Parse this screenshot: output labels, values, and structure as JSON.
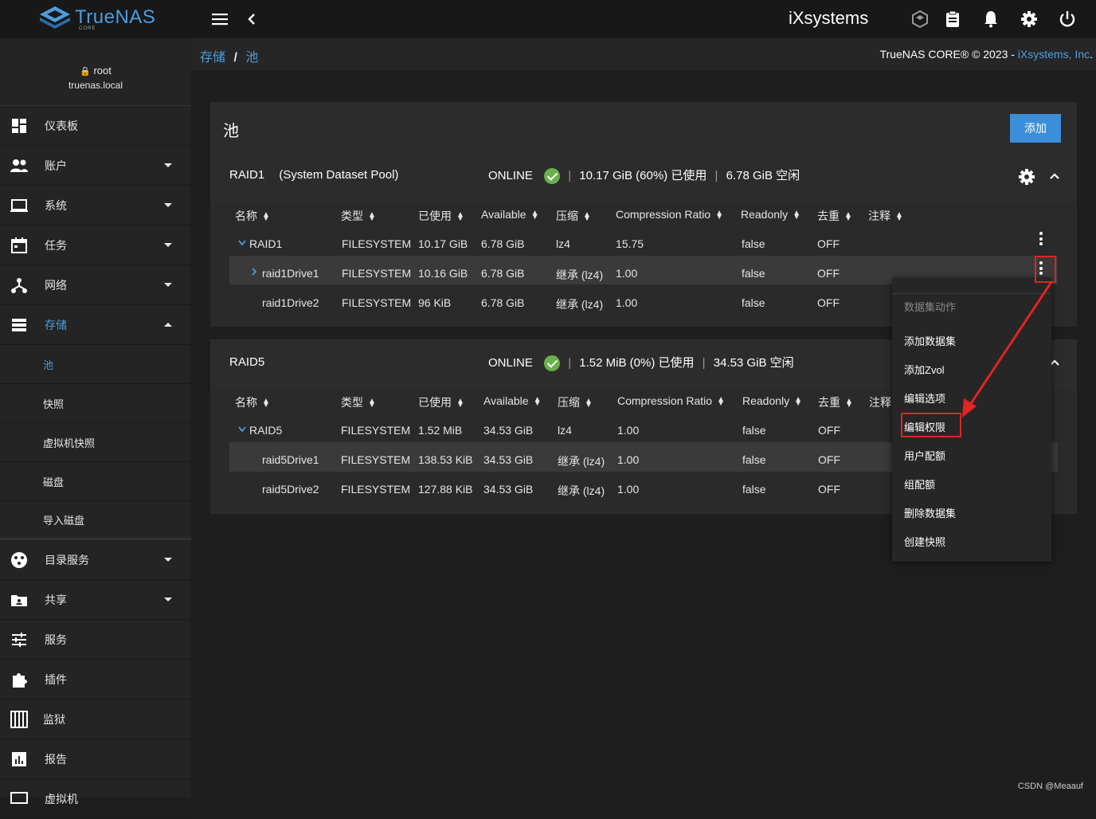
{
  "topbar": {
    "logo_text": "TrueNAS",
    "logo_sub": "CORE",
    "ix_logo": "iXsystems",
    "icons": [
      "menu-icon",
      "back-icon",
      "truecommand-icon",
      "clipboard-icon",
      "bell-icon",
      "gear-icon",
      "power-icon"
    ]
  },
  "user": {
    "name": "root",
    "host": "truenas.local"
  },
  "sidebar": {
    "items": [
      {
        "label": "仪表板",
        "icon": "dashboard-icon"
      },
      {
        "label": "账户",
        "icon": "accounts-icon"
      },
      {
        "label": "系统",
        "icon": "laptop-icon"
      },
      {
        "label": "任务",
        "icon": "calendar-icon"
      },
      {
        "label": "网络",
        "icon": "network-icon"
      },
      {
        "label": "存储",
        "icon": "storage-icon"
      },
      {
        "label": "目录服务",
        "icon": "directory-icon"
      },
      {
        "label": "共享",
        "icon": "share-icon"
      },
      {
        "label": "服务",
        "icon": "services-icon"
      },
      {
        "label": "插件",
        "icon": "puzzle-icon"
      },
      {
        "label": "监狱",
        "icon": "jail-icon"
      },
      {
        "label": "报告",
        "icon": "chart-icon"
      },
      {
        "label": "虚拟机",
        "icon": "vm-icon"
      }
    ],
    "storage_sub": [
      "池",
      "快照",
      "虚拟机快照",
      "磁盘",
      "导入磁盘"
    ]
  },
  "breadcrumb": {
    "part1": "存储",
    "sep": "/",
    "part2": "池"
  },
  "copyright": {
    "text": "TrueNAS CORE® © 2023 - ",
    "link": "iXsystems, Inc",
    "tail": "."
  },
  "page": {
    "title": "池",
    "add_label": "添加"
  },
  "pools": [
    {
      "name": "RAID1",
      "subtitle": "(System Dataset Pool)",
      "status": "ONLINE",
      "used": "10.17 GiB (60%) 已使用",
      "free": "6.78 GiB 空闲",
      "headers": [
        "名称",
        "类型",
        "已使用",
        "Available",
        "压缩",
        "Compression Ratio",
        "Readonly",
        "去重",
        "注释"
      ],
      "rows": [
        [
          "RAID1",
          "FILESYSTEM",
          "10.17 GiB",
          "6.78 GiB",
          "lz4",
          "15.75",
          "false",
          "OFF"
        ],
        [
          "raid1Drive1",
          "FILESYSTEM",
          "10.16 GiB",
          "6.78 GiB",
          "继承 (lz4)",
          "1.00",
          "false",
          "OFF"
        ],
        [
          "raid1Drive2",
          "FILESYSTEM",
          "96 KiB",
          "6.78 GiB",
          "继承 (lz4)",
          "1.00",
          "false",
          "OFF"
        ]
      ]
    },
    {
      "name": "RAID5",
      "status": "ONLINE",
      "used": "1.52 MiB (0%) 已使用",
      "free": "34.53 GiB 空闲",
      "headers": [
        "名称",
        "类型",
        "已使用",
        "Available",
        "压缩",
        "Compression Ratio",
        "Readonly",
        "去重",
        "注释"
      ],
      "rows": [
        [
          "RAID5",
          "FILESYSTEM",
          "1.52 MiB",
          "34.53 GiB",
          "lz4",
          "1.00",
          "false",
          "OFF"
        ],
        [
          "raid5Drive1",
          "FILESYSTEM",
          "138.53 KiB",
          "34.53 GiB",
          "继承 (lz4)",
          "1.00",
          "false",
          "OFF"
        ],
        [
          "raid5Drive2",
          "FILESYSTEM",
          "127.88 KiB",
          "34.53 GiB",
          "继承 (lz4)",
          "1.00",
          "false",
          "OFF"
        ]
      ]
    }
  ],
  "menu": {
    "title": "数据集动作",
    "items": [
      "添加数据集",
      "添加Zvol",
      "编辑选项",
      "编辑权限",
      "用户配额",
      "组配额",
      "删除数据集",
      "创建快照"
    ]
  },
  "watermark": "CSDN @Meaauf",
  "colors": {
    "accent": "#4c9ee0",
    "online": "#6ab04c",
    "highlight": "#e02424"
  }
}
